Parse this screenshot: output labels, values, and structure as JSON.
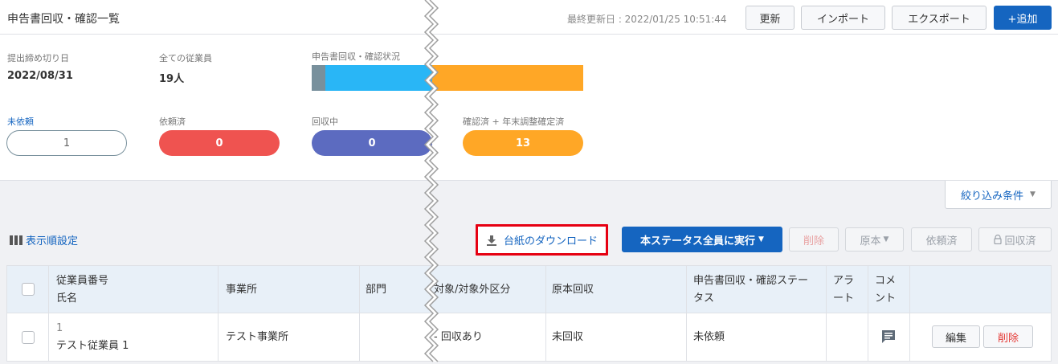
{
  "header": {
    "title": "申告書回収・確認一覧",
    "last_updated": "最終更新日 : 2022/01/25 10:51:44",
    "refresh_label": "更新",
    "import_label": "インポート",
    "export_label": "エクスポート",
    "add_label": "+追加"
  },
  "summary": {
    "deadline_label": "提出締め切り日",
    "deadline_value": "2022/08/31",
    "employees_label": "全ての従業員",
    "employees_value": "19人",
    "status_label": "申告書回収・確認状況",
    "progress": [
      {
        "fraction": 0.112,
        "color": "#78909c"
      },
      {
        "fraction": 0.888,
        "color": "#29b6f6"
      }
    ],
    "statuses": [
      {
        "label": "未依頼",
        "count": "1",
        "color": "#ffffff"
      },
      {
        "label": "依頼済",
        "count": "0",
        "color": "#ef5350"
      },
      {
        "label": "回収中",
        "count": "0",
        "color": "#5c6bc0"
      },
      {
        "label": "確認済 + 年末調整確定済",
        "count": "13",
        "color": "#ffa726"
      }
    ]
  },
  "toolbar": {
    "filter_label": "絞り込み条件",
    "display_setting_label": "表示順設定",
    "download_label": "台紙のダウンロード",
    "execute_label": "本ステータス全員に実行",
    "delete_label": "削除",
    "original_label": "原本",
    "requested_label": "依頼済",
    "collected_label": "回収済"
  },
  "table": {
    "headers": {
      "employee_no": "従業員番号",
      "name": "氏名",
      "office": "事業所",
      "department": "部門",
      "target": "対象/対象外区分",
      "original": "原本回収",
      "status_line1": "申告書回収・確認ステー",
      "status_line2": "タス",
      "alert_line1": "アラ",
      "alert_line2": "ート",
      "comment_line1": "コメ",
      "comment_line2": "ント"
    },
    "rows": [
      {
        "employee_no": "1",
        "name": "テスト従業員 1",
        "office": "テスト事業所",
        "department": "",
        "target": "- 回収あり",
        "original": "未回収",
        "status": "未依頼",
        "edit_label": "編集",
        "delete_label": "削除"
      }
    ]
  },
  "colors": {
    "accent": "#1565c0",
    "highlight_border": "#e60012",
    "progress_orange": "#ffa726"
  },
  "icons": {
    "download": "download-icon",
    "columns": "columns-icon",
    "comment": "comment-icon",
    "lock": "lock-icon",
    "caret": "caret-down-icon"
  }
}
